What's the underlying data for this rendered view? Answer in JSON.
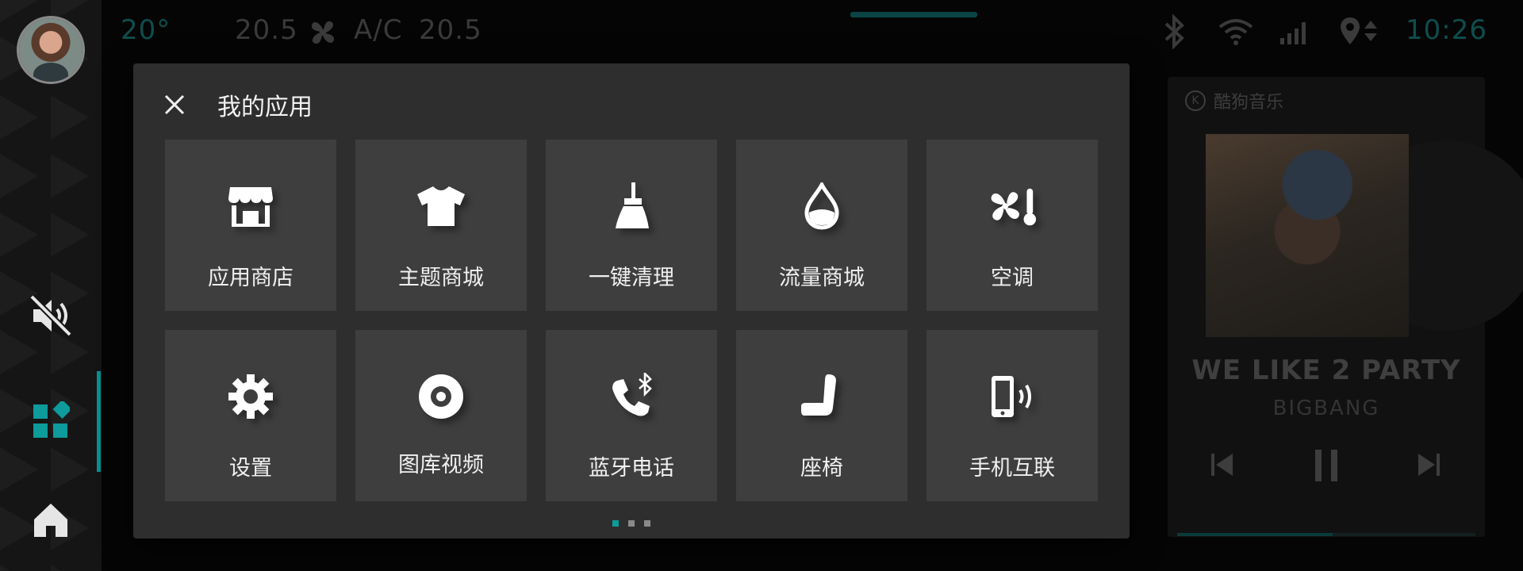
{
  "status_bar": {
    "outside_temp": "20°",
    "left_temp": "20.5",
    "ac_label": "A/C",
    "right_temp": "20.5",
    "clock": "10:26"
  },
  "sidebar": {
    "items": [
      {
        "icon": "avatar"
      },
      {
        "icon": "mute-icon"
      },
      {
        "icon": "apps-grid-icon",
        "active": true
      },
      {
        "icon": "home-icon"
      }
    ]
  },
  "dialog": {
    "title": "我的应用",
    "apps": [
      {
        "label": "应用商店",
        "icon": "store-icon"
      },
      {
        "label": "主题商城",
        "icon": "tshirt-icon"
      },
      {
        "label": "一键清理",
        "icon": "broom-icon"
      },
      {
        "label": "流量商城",
        "icon": "droplet-icon"
      },
      {
        "label": "空调",
        "icon": "fan-thermometer-icon"
      },
      {
        "label": "设置",
        "icon": "gear-icon"
      },
      {
        "label": "图库视频",
        "icon": "disc-icon"
      },
      {
        "label": "蓝牙电话",
        "icon": "bluetooth-phone-icon"
      },
      {
        "label": "座椅",
        "icon": "seat-icon"
      },
      {
        "label": "手机互联",
        "icon": "phone-link-icon"
      }
    ],
    "pages": 3,
    "current_page": 1
  },
  "music": {
    "source": "酷狗音乐",
    "source_badge": "K",
    "title": "WE LIKE 2 PARTY",
    "artist": "BIGBANG",
    "progress": 0.52
  },
  "colors": {
    "accent": "#0d9b9b",
    "dialog_bg": "#2e2e2e",
    "tile_bg": "#3e3e3e"
  }
}
